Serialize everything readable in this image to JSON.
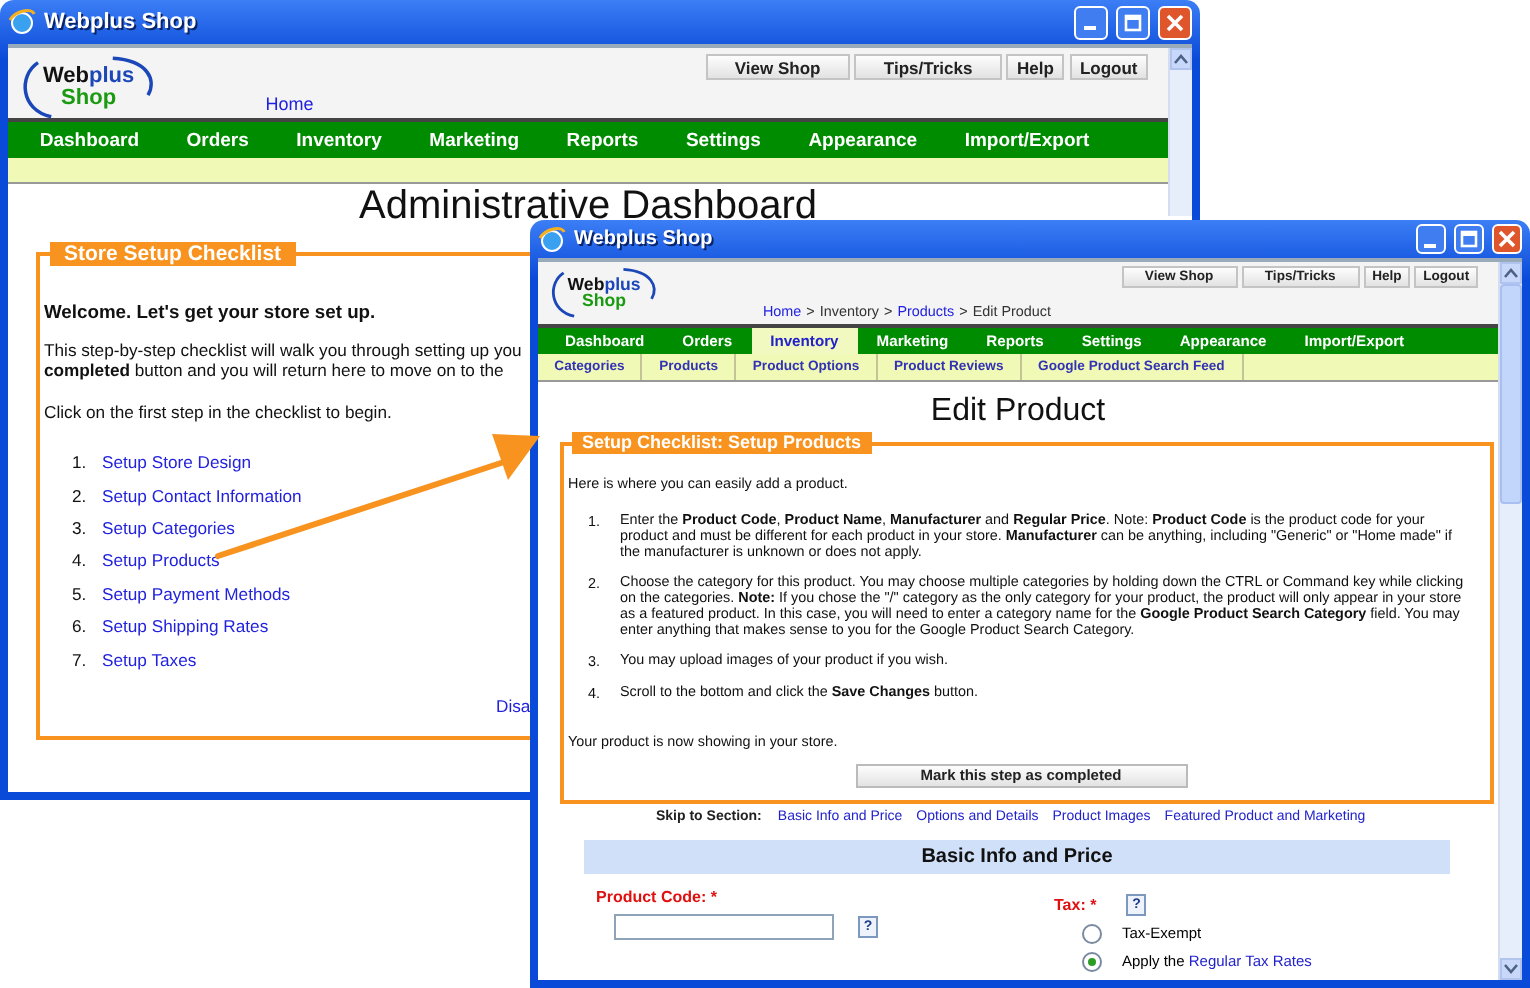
{
  "dashboard_window": {
    "title": "Webplus Shop",
    "logo": {
      "web": "Web",
      "plus": "plus",
      "shop": "Shop"
    },
    "header_buttons": [
      "View Shop",
      "Tips/Tricks",
      "Help",
      "Logout"
    ],
    "breadcrumb": {
      "items": [
        {
          "text": "Home",
          "link": true
        }
      ]
    },
    "nav": [
      {
        "label": "Dashboard",
        "selected": false
      },
      {
        "label": "Orders",
        "selected": false
      },
      {
        "label": "Inventory",
        "selected": false
      },
      {
        "label": "Marketing",
        "selected": false
      },
      {
        "label": "Reports",
        "selected": false
      },
      {
        "label": "Settings",
        "selected": false
      },
      {
        "label": "Appearance",
        "selected": false
      },
      {
        "label": "Import/Export",
        "selected": false
      }
    ],
    "page_title": "Administrative Dashboard",
    "checklist": {
      "legend": "Store Setup Checklist",
      "welcome": "Welcome. Let's get your store set up.",
      "intro_lines": [
        "This step-by-step checklist will walk you through setting up you",
        "**completed** button and you will return here to move on to the"
      ],
      "prompt": "Click on the first step in the checklist to begin.",
      "steps": [
        {
          "number": "1.",
          "label": "Setup Store Design"
        },
        {
          "number": "2.",
          "label": "Setup Contact Information"
        },
        {
          "number": "3.",
          "label": "Setup Categories"
        },
        {
          "number": "4.",
          "label": "Setup Products"
        },
        {
          "number": "5.",
          "label": "Setup Payment Methods"
        },
        {
          "number": "6.",
          "label": "Setup Shipping Rates"
        },
        {
          "number": "7.",
          "label": "Setup Taxes"
        }
      ],
      "footer_link": "Disa"
    }
  },
  "edit_product_window": {
    "title": "Webplus Shop",
    "logo": {
      "web": "Web",
      "plus": "plus",
      "shop": "Shop"
    },
    "header_buttons": [
      "View Shop",
      "Tips/Tricks",
      "Help",
      "Logout"
    ],
    "breadcrumb": {
      "separator": ">",
      "items": [
        {
          "text": "Home",
          "link": true
        },
        {
          "text": "Inventory",
          "link": false
        },
        {
          "text": "Products",
          "link": true
        },
        {
          "text": "Edit Product",
          "link": false
        }
      ]
    },
    "nav": [
      {
        "label": "Dashboard",
        "selected": false
      },
      {
        "label": "Orders",
        "selected": false
      },
      {
        "label": "Inventory",
        "selected": true
      },
      {
        "label": "Marketing",
        "selected": false
      },
      {
        "label": "Reports",
        "selected": false
      },
      {
        "label": "Settings",
        "selected": false
      },
      {
        "label": "Appearance",
        "selected": false
      },
      {
        "label": "Import/Export",
        "selected": false
      }
    ],
    "subnav": [
      "Categories",
      "Products",
      "Product Options",
      "Product Reviews",
      "Google Product Search Feed"
    ],
    "page_title": "Edit Product",
    "checklist": {
      "legend": "Setup Checklist: Setup Products",
      "intro": "Here is where you can easily add a product.",
      "steps": [
        {
          "number": "1.",
          "text": "Enter the **Product Code**, **Product Name**, **Manufacturer** and **Regular Price**. Note: **Product Code** is the product code for your product and must be different for each product in your store. **Manufacturer** can be anything, including \"Generic\" or \"Home made\" if the manufacturer is unknown or does not apply."
        },
        {
          "number": "2.",
          "text": "Choose the category for this product. You may choose multiple categories by holding down the CTRL or Command key while clicking on the categories. **Note:** If you chose the \"/\" category as the only category for your product, the product will only appear in your store as a featured product. In this case, you will need to enter a category name for the **Google Product Search Category** field. You may enter anything that makes sense to you for the Google Product Search Category."
        },
        {
          "number": "3.",
          "text": "You may upload images of your product if you wish."
        },
        {
          "number": "4.",
          "text": "Scroll to the bottom and click the **Save Changes** button."
        }
      ],
      "outro": "Your product is now showing in your store.",
      "button": "Mark this step as completed"
    },
    "skip": {
      "label": "Skip to Section:",
      "links": [
        "Basic Info and Price",
        "Options and Details",
        "Product Images",
        "Featured Product and Marketing"
      ]
    },
    "section_title": "Basic Info and Price",
    "product_code": {
      "label": "Product Code: *",
      "help": "?"
    },
    "tax": {
      "label": "Tax: *",
      "help": "?",
      "options": [
        {
          "text": "Tax-Exempt",
          "selected": false
        },
        {
          "text": "Apply the",
          "link": "Regular Tax Rates",
          "selected": true
        }
      ]
    }
  }
}
